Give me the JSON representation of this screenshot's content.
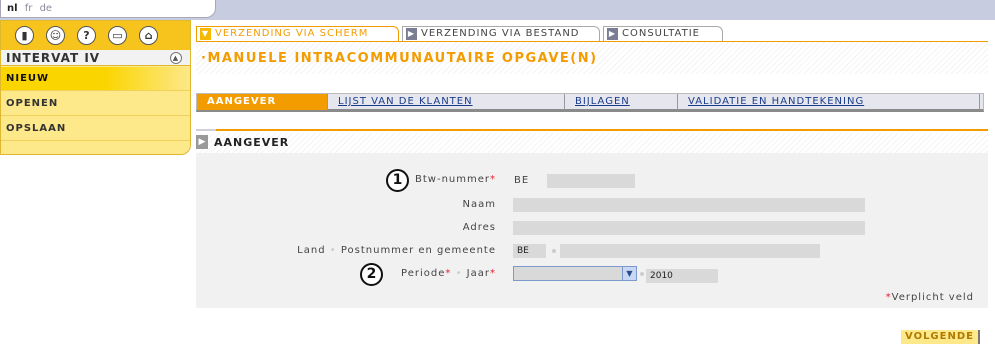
{
  "languages": {
    "nl": "nl",
    "fr": "fr",
    "de": "de"
  },
  "toolbar_icons": [
    "door-icon",
    "user-icon",
    "help-icon",
    "print-icon",
    "home-icon"
  ],
  "icons_glyphs": {
    "door": "▮",
    "user": "☺",
    "help": "?",
    "print": "▭",
    "home": "⌂"
  },
  "app_title": "INTERVAT IV",
  "collapse_glyph": "▲",
  "menu": {
    "new": "NIEUW",
    "open": "OPENEN",
    "save": "OPSLAAN"
  },
  "top_tabs": {
    "screen": "VERZENDING VIA SCHERM",
    "file": "VERZENDING VIA BESTAND",
    "consult": "CONSULTATIE"
  },
  "page_title": "·MANUELE INTRACOMMUNAUTAIRE OPGAVE(N)",
  "sub_tabs": {
    "declarant": "AANGEVER",
    "clients": "LIJST VAN DE KLANTEN",
    "attachments": "BIJLAGEN",
    "validation": "VALIDATIE EN HANDTEKENING"
  },
  "section_title": "AANGEVER",
  "form": {
    "vat_label": "Btw-nummer",
    "vat_prefix": "BE",
    "name_label": "Naam",
    "address_label": "Adres",
    "country_label": "Land",
    "postal_label": "Postnummer en gemeente",
    "country_value": "BE",
    "period_label": "Periode",
    "year_label": "Jaar",
    "year_value": "2010",
    "required_marker": "*",
    "required_note": "Verplicht veld"
  },
  "callouts": {
    "one": "1",
    "two": "2"
  },
  "next_button": "VOLGENDE",
  "colors": {
    "accent": "#f39c00",
    "panel": "#fde88a",
    "required": "#e02030"
  }
}
